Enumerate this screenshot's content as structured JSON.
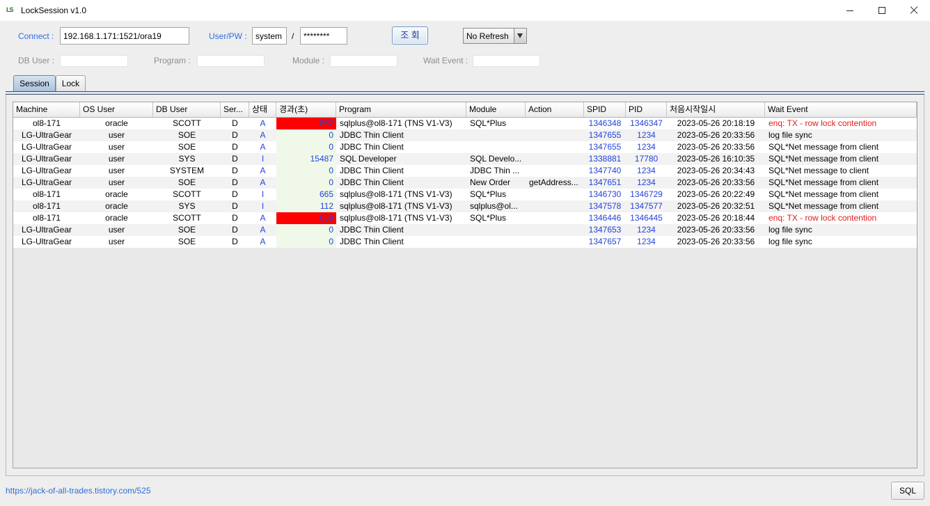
{
  "window": {
    "title": "LockSession v1.0",
    "icon_text": "LS"
  },
  "icons": {
    "app": "app-logo-icon",
    "minimize": "minimize-icon",
    "maximize": "maximize-icon",
    "close": "close-icon",
    "dropdown": "chevron-down-icon"
  },
  "connect": {
    "label": "Connect :",
    "value": "192.168.1.171:1521/ora19"
  },
  "user": {
    "label": "User/PW :",
    "value": "system",
    "separator": "/",
    "password": "********"
  },
  "query_button": "조 회",
  "refresh": {
    "selected": "No Refresh"
  },
  "filters": [
    {
      "label": "DB User :",
      "value": ""
    },
    {
      "label": "Program :",
      "value": ""
    },
    {
      "label": "Module :",
      "value": ""
    },
    {
      "label": "Wait Event :",
      "value": ""
    }
  ],
  "tabs": [
    {
      "label": "Session",
      "selected": true
    },
    {
      "label": "Lock",
      "selected": false
    }
  ],
  "table": {
    "columns": [
      "Machine",
      "OS User",
      "DB User",
      "Ser...",
      "상태",
      "경과(초)",
      "Program",
      "Module",
      "Action",
      "SPID",
      "PID",
      "처음시작일시",
      "Wait Event"
    ],
    "rows": [
      {
        "alert": true,
        "cells": [
          "ol8-171",
          "oracle",
          "SCOTT",
          "D",
          "A",
          "652",
          "sqlplus@ol8-171 (TNS V1-V3)",
          "SQL*Plus",
          "",
          "1346348",
          "1346347",
          "2023-05-26 20:18:19",
          "enq: TX - row lock contention"
        ]
      },
      {
        "alert": false,
        "cells": [
          "LG-UltraGear",
          "user",
          "SOE",
          "D",
          "A",
          "0",
          "JDBC Thin Client",
          "",
          "",
          "1347655",
          "1234",
          "2023-05-26 20:33:56",
          "log file sync"
        ]
      },
      {
        "alert": false,
        "cells": [
          "LG-UltraGear",
          "user",
          "SOE",
          "D",
          "A",
          "0",
          "JDBC Thin Client",
          "",
          "",
          "1347655",
          "1234",
          "2023-05-26 20:33:56",
          "SQL*Net message from client"
        ]
      },
      {
        "alert": false,
        "cells": [
          "LG-UltraGear",
          "user",
          "SYS",
          "D",
          "I",
          "15487",
          "SQL Developer",
          "SQL Develo...",
          "",
          "1338881",
          "17780",
          "2023-05-26 16:10:35",
          "SQL*Net message from client"
        ]
      },
      {
        "alert": false,
        "cells": [
          "LG-UltraGear",
          "user",
          "SYSTEM",
          "D",
          "A",
          "0",
          "JDBC Thin Client",
          "JDBC Thin ...",
          "",
          "1347740",
          "1234",
          "2023-05-26 20:34:43",
          "SQL*Net message to client"
        ]
      },
      {
        "alert": false,
        "cells": [
          "LG-UltraGear",
          "user",
          "SOE",
          "D",
          "A",
          "0",
          "JDBC Thin Client",
          "New Order",
          "getAddress...",
          "1347651",
          "1234",
          "2023-05-26 20:33:56",
          "SQL*Net message from client"
        ]
      },
      {
        "alert": false,
        "cells": [
          "ol8-171",
          "oracle",
          "SCOTT",
          "D",
          "I",
          "665",
          "sqlplus@ol8-171 (TNS V1-V3)",
          "SQL*Plus",
          "",
          "1346730",
          "1346729",
          "2023-05-26 20:22:49",
          "SQL*Net message from client"
        ]
      },
      {
        "alert": false,
        "cells": [
          "ol8-171",
          "oracle",
          "SYS",
          "D",
          "I",
          "112",
          "sqlplus@ol8-171 (TNS V1-V3)",
          "sqlplus@ol...",
          "",
          "1347578",
          "1347577",
          "2023-05-26 20:32:51",
          "SQL*Net message from client"
        ]
      },
      {
        "alert": true,
        "cells": [
          "ol8-171",
          "oracle",
          "SCOTT",
          "D",
          "A",
          "639",
          "sqlplus@ol8-171 (TNS V1-V3)",
          "SQL*Plus",
          "",
          "1346446",
          "1346445",
          "2023-05-26 20:18:44",
          "enq: TX - row lock contention"
        ]
      },
      {
        "alert": false,
        "cells": [
          "LG-UltraGear",
          "user",
          "SOE",
          "D",
          "A",
          "0",
          "JDBC Thin Client",
          "",
          "",
          "1347653",
          "1234",
          "2023-05-26 20:33:56",
          "log file sync"
        ]
      },
      {
        "alert": false,
        "cells": [
          "LG-UltraGear",
          "user",
          "SOE",
          "D",
          "A",
          "0",
          "JDBC Thin Client",
          "",
          "",
          "1347657",
          "1234",
          "2023-05-26 20:33:56",
          "log file sync"
        ]
      }
    ]
  },
  "footer": {
    "link": "https://jack-of-all-trades.tistory.com/525",
    "sql_button": "SQL"
  },
  "colors": {
    "label_blue": "#2f6be0",
    "label_gray": "#8c8c8c",
    "value_blue": "#2343d9",
    "elapsed_bg": "#eff8e9",
    "alert_bg": "#ff0000",
    "alert_text": "#e31b1b",
    "link_blue": "#2e6fd8"
  }
}
